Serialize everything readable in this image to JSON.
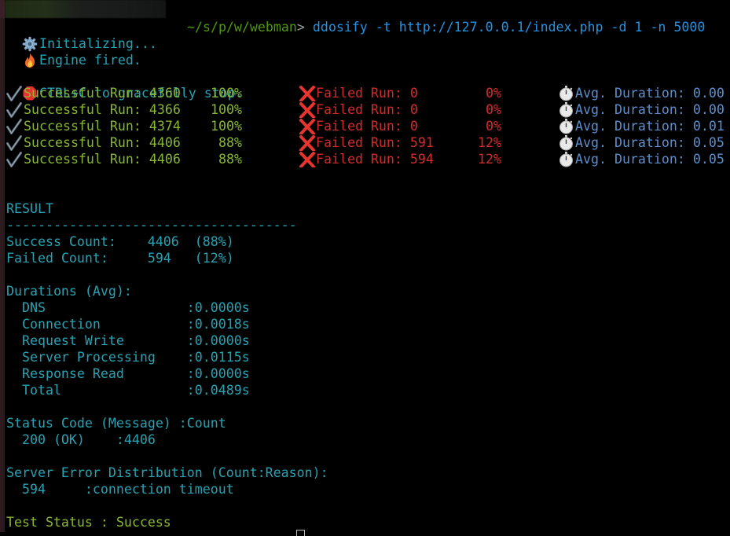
{
  "terminal": {
    "prompt": {
      "path": "~/s/p/w/webman",
      "symbol": ">",
      "command": "ddosify -t http://127.0.0.1/index.php -d 1 -n 5000"
    },
    "status_lines": [
      {
        "icon": "gear-icon",
        "text": "Initializing..."
      },
      {
        "icon": "fire-icon",
        "text": "Engine fired."
      },
      {
        "icon": "stop-sign-icon",
        "text": "CTRL+C to gracefully stop."
      }
    ],
    "progress_rows": [
      {
        "success_label": "Successful Run: 4360",
        "success_pct": "100%",
        "failed_label": "Failed Run: 0",
        "failed_pct": "0%",
        "duration_label": "Avg. Duration: 0.00"
      },
      {
        "success_label": "Successful Run: 4366",
        "success_pct": "100%",
        "failed_label": "Failed Run: 0",
        "failed_pct": "0%",
        "duration_label": "Avg. Duration: 0.00"
      },
      {
        "success_label": "Successful Run: 4374",
        "success_pct": "100%",
        "failed_label": "Failed Run: 0",
        "failed_pct": "0%",
        "duration_label": "Avg. Duration: 0.01"
      },
      {
        "success_label": "Successful Run: 4406",
        "success_pct": "88%",
        "failed_label": "Failed Run: 591",
        "failed_pct": "12%",
        "duration_label": "Avg. Duration: 0.05"
      },
      {
        "success_label": "Successful Run: 4406",
        "success_pct": "88%",
        "failed_label": "Failed Run: 594",
        "failed_pct": "12%",
        "duration_label": "Avg. Duration: 0.05"
      }
    ],
    "result": {
      "heading": "RESULT",
      "divider": "-------------------------------------",
      "success_count_line": "Success Count:    4406  (88%)",
      "failed_count_line": "Failed Count:     594   (12%)",
      "durations_heading": "Durations (Avg):",
      "durations": [
        {
          "line": "  DNS                  :0.0000s"
        },
        {
          "line": "  Connection           :0.0018s"
        },
        {
          "line": "  Request Write        :0.0000s"
        },
        {
          "line": "  Server Processing    :0.0115s"
        },
        {
          "line": "  Response Read        :0.0000s"
        },
        {
          "line": "  Total                :0.0489s"
        }
      ],
      "status_code_heading": "Status Code (Message) :Count",
      "status_code_line": "  200 (OK)    :4406",
      "error_dist_heading": "Server Error Distribution (Count:Reason):",
      "error_dist_line": "  594     :connection timeout",
      "test_status": "Test Status : Success"
    }
  }
}
